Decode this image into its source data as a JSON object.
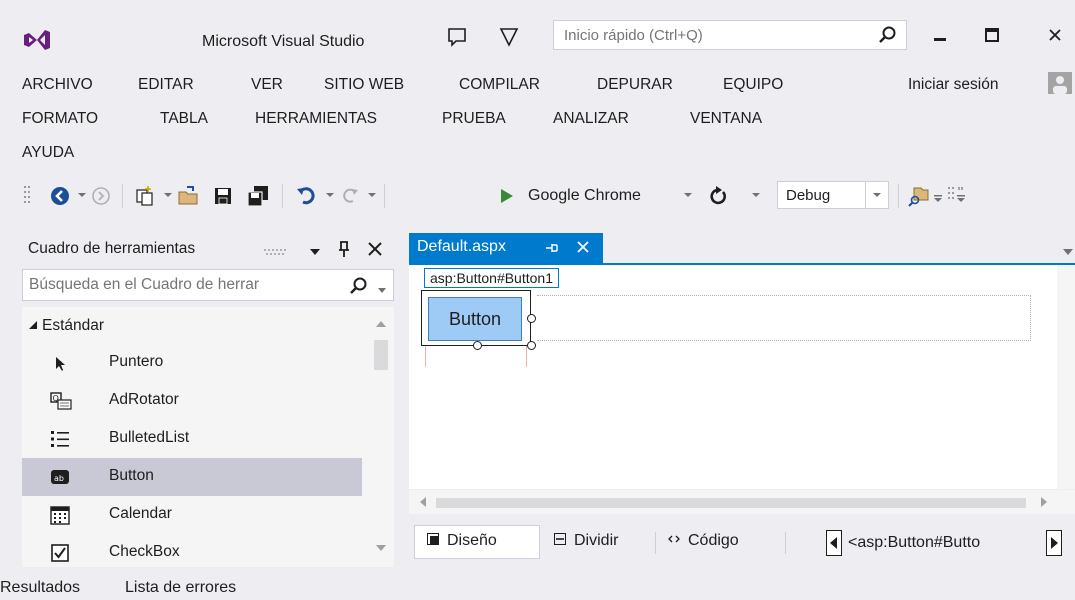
{
  "app": {
    "title": "Microsoft Visual Studio",
    "quick_launch_placeholder": "Inicio rápido (Ctrl+Q)",
    "signin": "Iniciar sesión"
  },
  "menu": {
    "archivo": "ARCHIVO",
    "editar": "EDITAR",
    "ver": "VER",
    "sitio_web": "SITIO WEB",
    "compilar": "COMPILAR",
    "depurar": "DEPURAR",
    "equipo": "EQUIPO",
    "formato": "FORMATO",
    "tabla": "TABLA",
    "herramientas": "HERRAMIENTAS",
    "prueba": "PRUEBA",
    "analizar": "ANALIZAR",
    "ventana": "VENTANA",
    "ayuda": "AYUDA"
  },
  "toolbar": {
    "run_target": "Google Chrome",
    "configuration": "Debug"
  },
  "toolbox": {
    "title": "Cuadro de herramientas",
    "search_placeholder": "Búsqueda en el Cuadro de herrar",
    "category": "Estándar",
    "items": [
      {
        "label": "Puntero",
        "icon": "pointer-icon"
      },
      {
        "label": "AdRotator",
        "icon": "adrotator-icon"
      },
      {
        "label": "BulletedList",
        "icon": "bulleted-list-icon"
      },
      {
        "label": "Button",
        "icon": "button-control-icon",
        "selected": true
      },
      {
        "label": "Calendar",
        "icon": "calendar-icon"
      },
      {
        "label": "CheckBox",
        "icon": "checkbox-icon"
      }
    ]
  },
  "document": {
    "tab_label": "Default.aspx",
    "element_tag": "asp:Button#Button1",
    "button_text": "Button",
    "views": {
      "design": "Diseño",
      "split": "Dividir",
      "code": "Código"
    },
    "path": "<asp:Button#Butto"
  },
  "bottom_tabs": {
    "output": "Resultados",
    "error_list": "Lista de errores"
  },
  "colors": {
    "accent": "#007ACC",
    "chrome_bg": "#EEEEF2",
    "vs_purple": "#68217A",
    "run_green": "#388A34",
    "selected_item": "#C9C9D6"
  }
}
